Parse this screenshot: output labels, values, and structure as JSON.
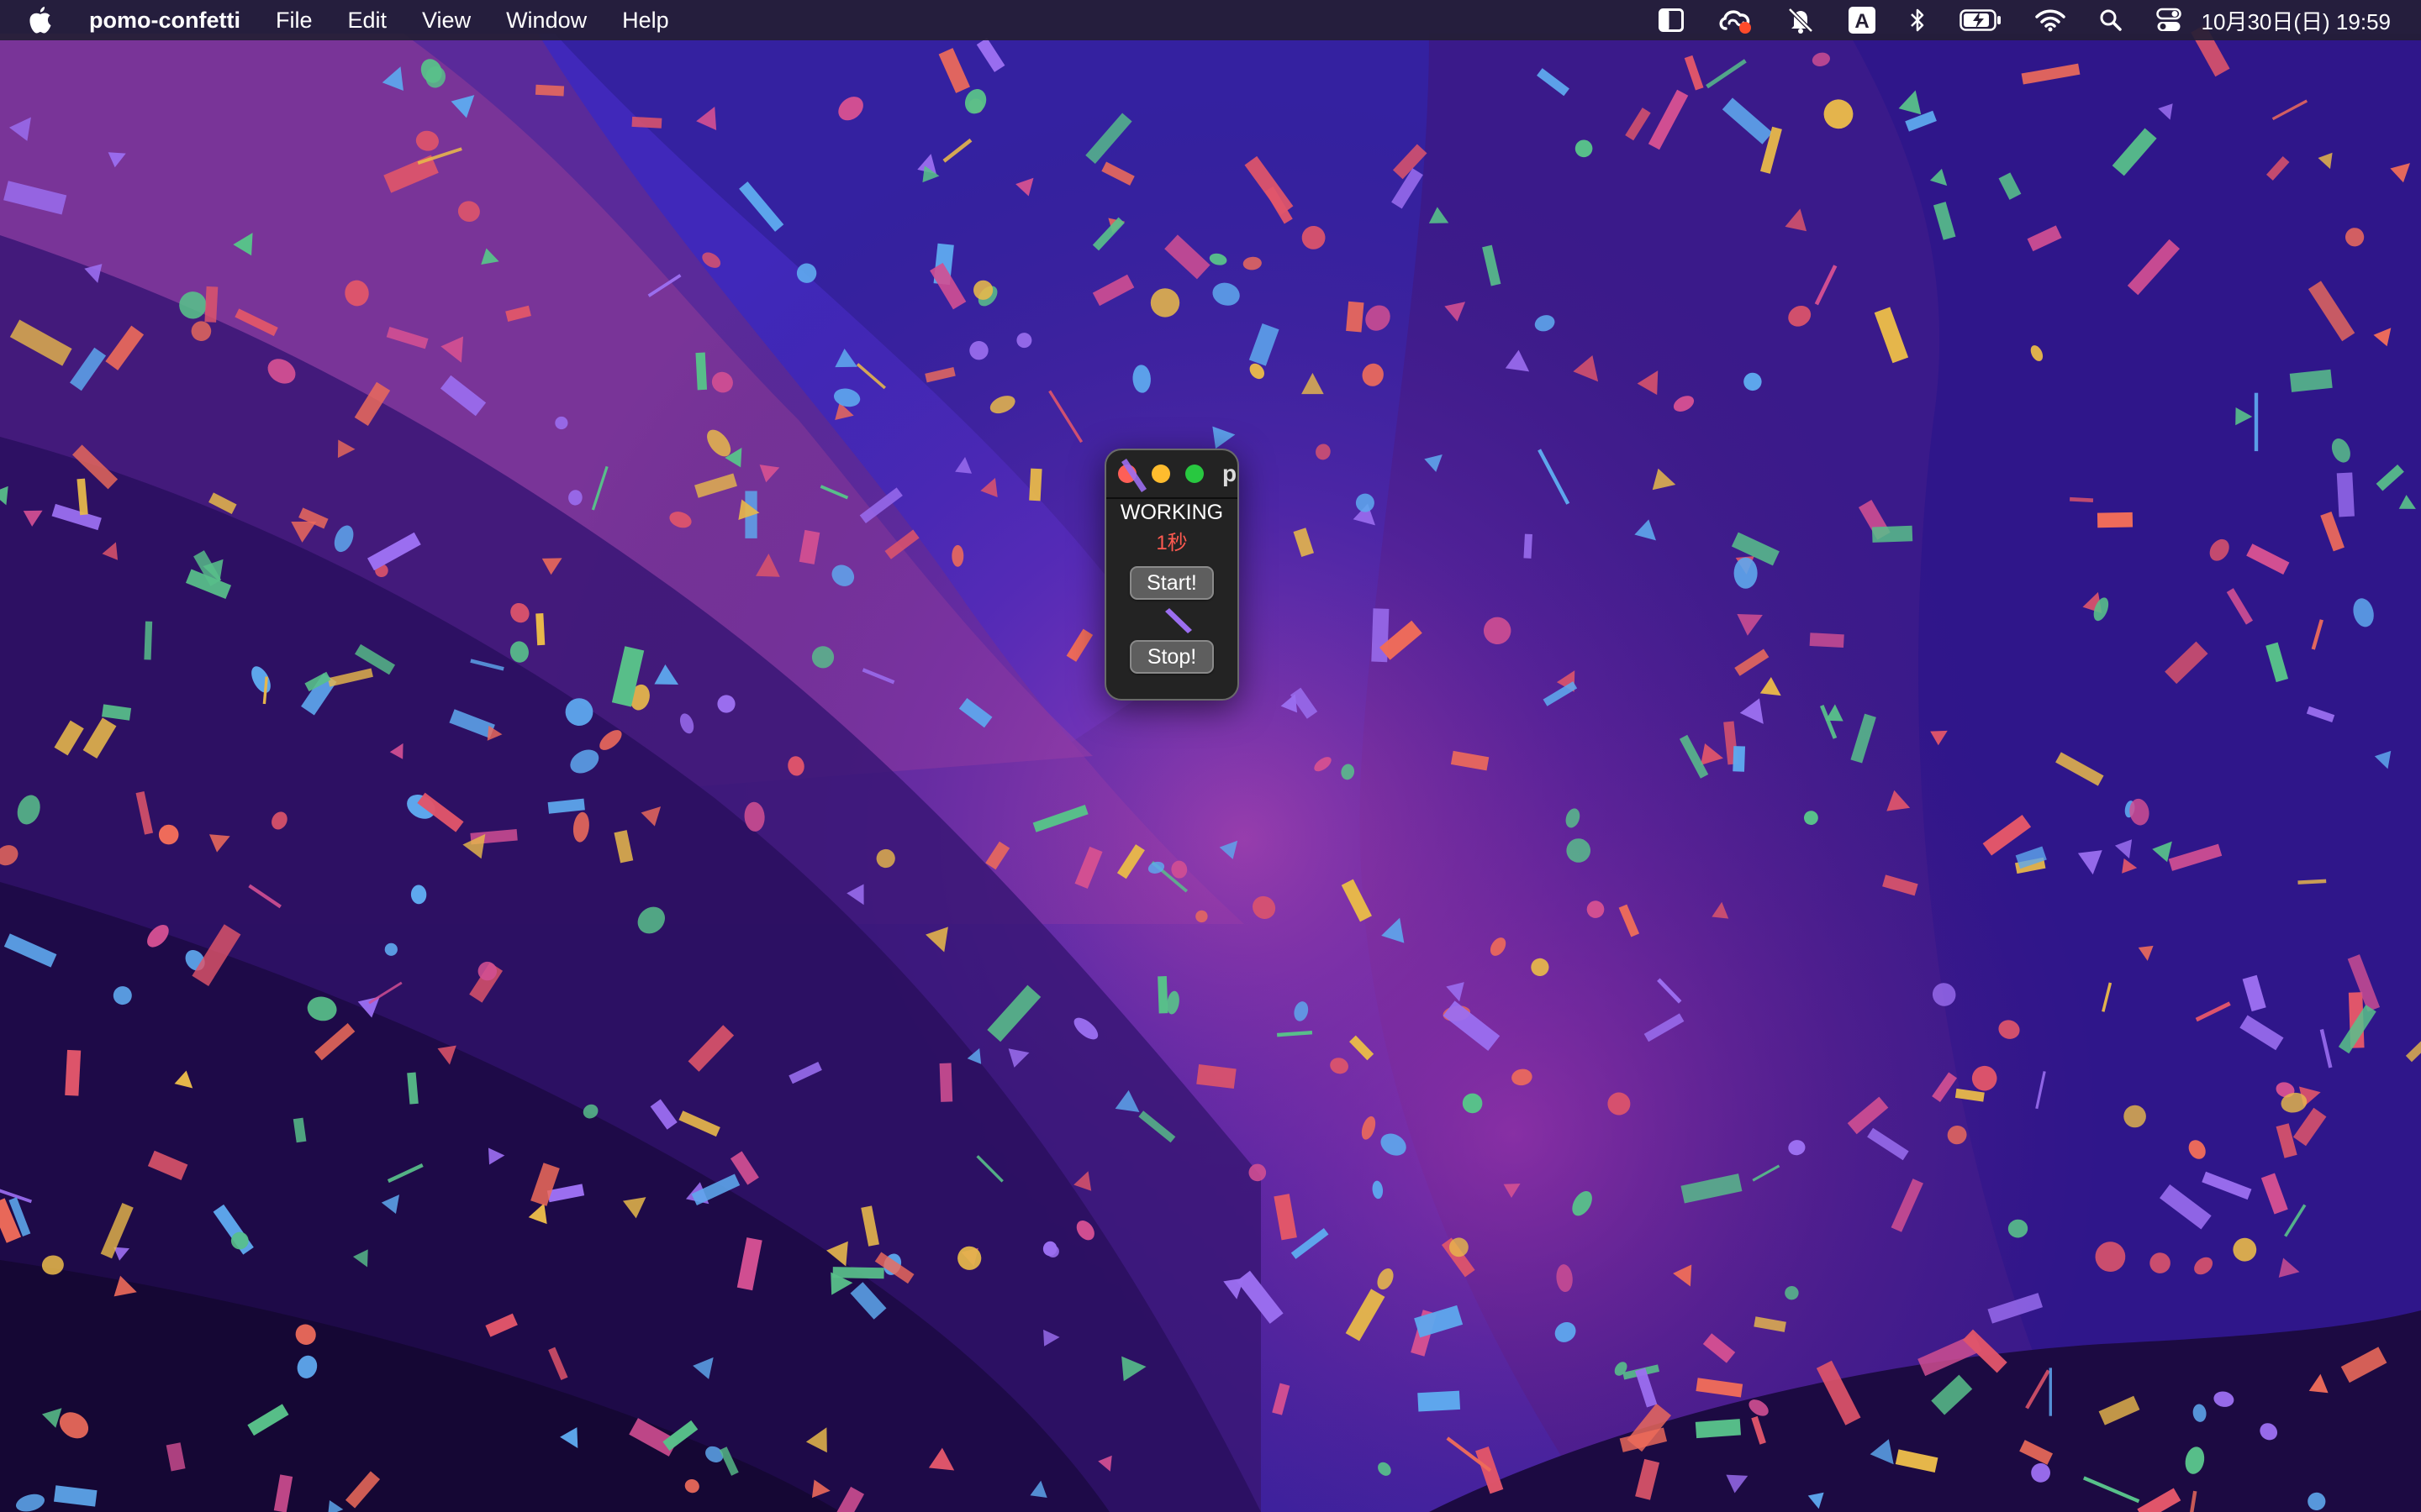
{
  "menubar": {
    "app_name": "pomo-confetti",
    "items": [
      "File",
      "Edit",
      "View",
      "Window",
      "Help"
    ],
    "clock": "10月30日(日) 19:59",
    "status_icons": [
      "sidebar-icon",
      "creative-cloud-icon",
      "notification-icon",
      "input-source-icon",
      "bluetooth-icon",
      "battery-icon",
      "wifi-icon",
      "spotlight-search-icon",
      "control-center-icon"
    ],
    "input_source_letter": "A"
  },
  "window": {
    "title": "p",
    "status": "WORKING",
    "timer": "1秒",
    "start_label": "Start!",
    "stop_label": "Stop!"
  },
  "colors": {
    "confetti": [
      "#e8b84a",
      "#e0556a",
      "#d24f92",
      "#9b6ef0",
      "#5ea8ee",
      "#58c08a",
      "#ee6b5a"
    ],
    "timer_text": "#ff5a50",
    "traffic_close": "#fe5f57",
    "traffic_minimize": "#febc2e",
    "traffic_maximize": "#28c840"
  }
}
